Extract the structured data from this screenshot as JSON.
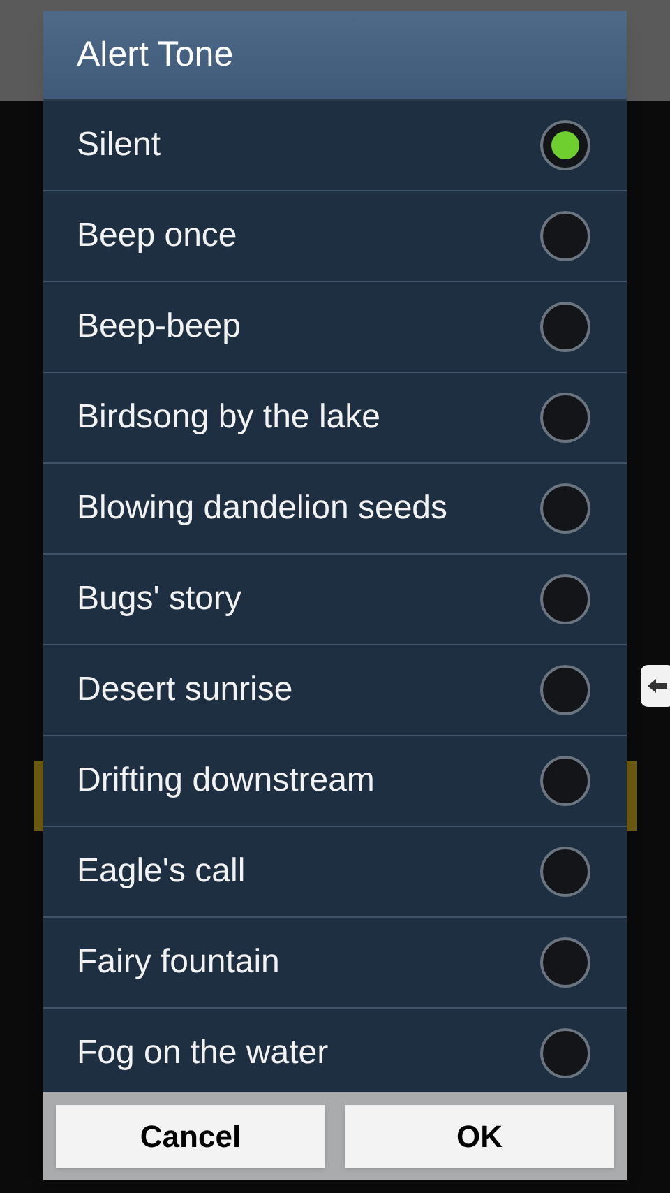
{
  "dialog": {
    "title": "Alert Tone",
    "options": [
      {
        "label": "Silent",
        "selected": true
      },
      {
        "label": "Beep once",
        "selected": false
      },
      {
        "label": "Beep-beep",
        "selected": false
      },
      {
        "label": "Birdsong by the lake",
        "selected": false
      },
      {
        "label": "Blowing dandelion seeds",
        "selected": false
      },
      {
        "label": "Bugs' story",
        "selected": false
      },
      {
        "label": "Desert sunrise",
        "selected": false
      },
      {
        "label": "Drifting downstream",
        "selected": false
      },
      {
        "label": "Eagle's call",
        "selected": false
      },
      {
        "label": "Fairy fountain",
        "selected": false
      },
      {
        "label": "Fog on the water",
        "selected": false
      }
    ],
    "buttons": [
      "Cancel",
      "OK"
    ]
  }
}
